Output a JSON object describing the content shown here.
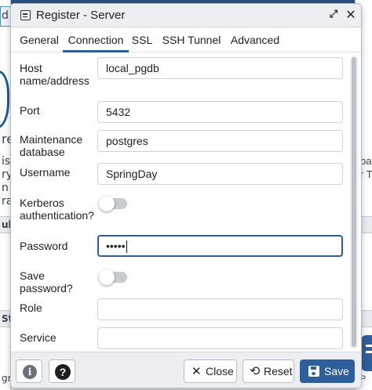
{
  "dialog": {
    "title": "Register - Server",
    "expand_glyph": "⤢",
    "close_glyph": "✕"
  },
  "tabs": [
    {
      "label": "General",
      "active": false
    },
    {
      "label": "Connection",
      "active": true
    },
    {
      "label": "SSL",
      "active": false
    },
    {
      "label": "SSH Tunnel",
      "active": false
    },
    {
      "label": "Advanced",
      "active": false
    }
  ],
  "fields": {
    "host": {
      "label": "Host name/address",
      "value": "local_pgdb"
    },
    "port": {
      "label": "Port",
      "value": "5432"
    },
    "maintenance_db": {
      "label": "Maintenance database",
      "value": "postgres"
    },
    "username": {
      "label": "Username",
      "value": "SpringDay"
    },
    "kerberos": {
      "label": "Kerberos authentication?",
      "enabled": false
    },
    "password": {
      "label": "Password",
      "value": "•••••"
    },
    "save_password": {
      "label": "Save password?",
      "enabled": false
    },
    "role": {
      "label": "Role",
      "value": ""
    },
    "service": {
      "label": "Service",
      "value": ""
    }
  },
  "footer": {
    "info_glyph": "i",
    "help_glyph": "?",
    "close_label": "Close",
    "close_glyph": "✕",
    "reset_label": "Reset",
    "reset_glyph": "⟲",
    "save_label": "Save"
  },
  "background": {
    "left_fragments": [
      "d",
      "re",
      "is",
      "ry",
      "n",
      "ra",
      "uk",
      "Sta",
      "gre"
    ],
    "right_fragments": [
      "ba",
      "r T",
      "P"
    ]
  },
  "colors": {
    "accent": "#2e5f9c",
    "titlebar": "#eceef1",
    "toggle_off": "#c8cbd0"
  }
}
